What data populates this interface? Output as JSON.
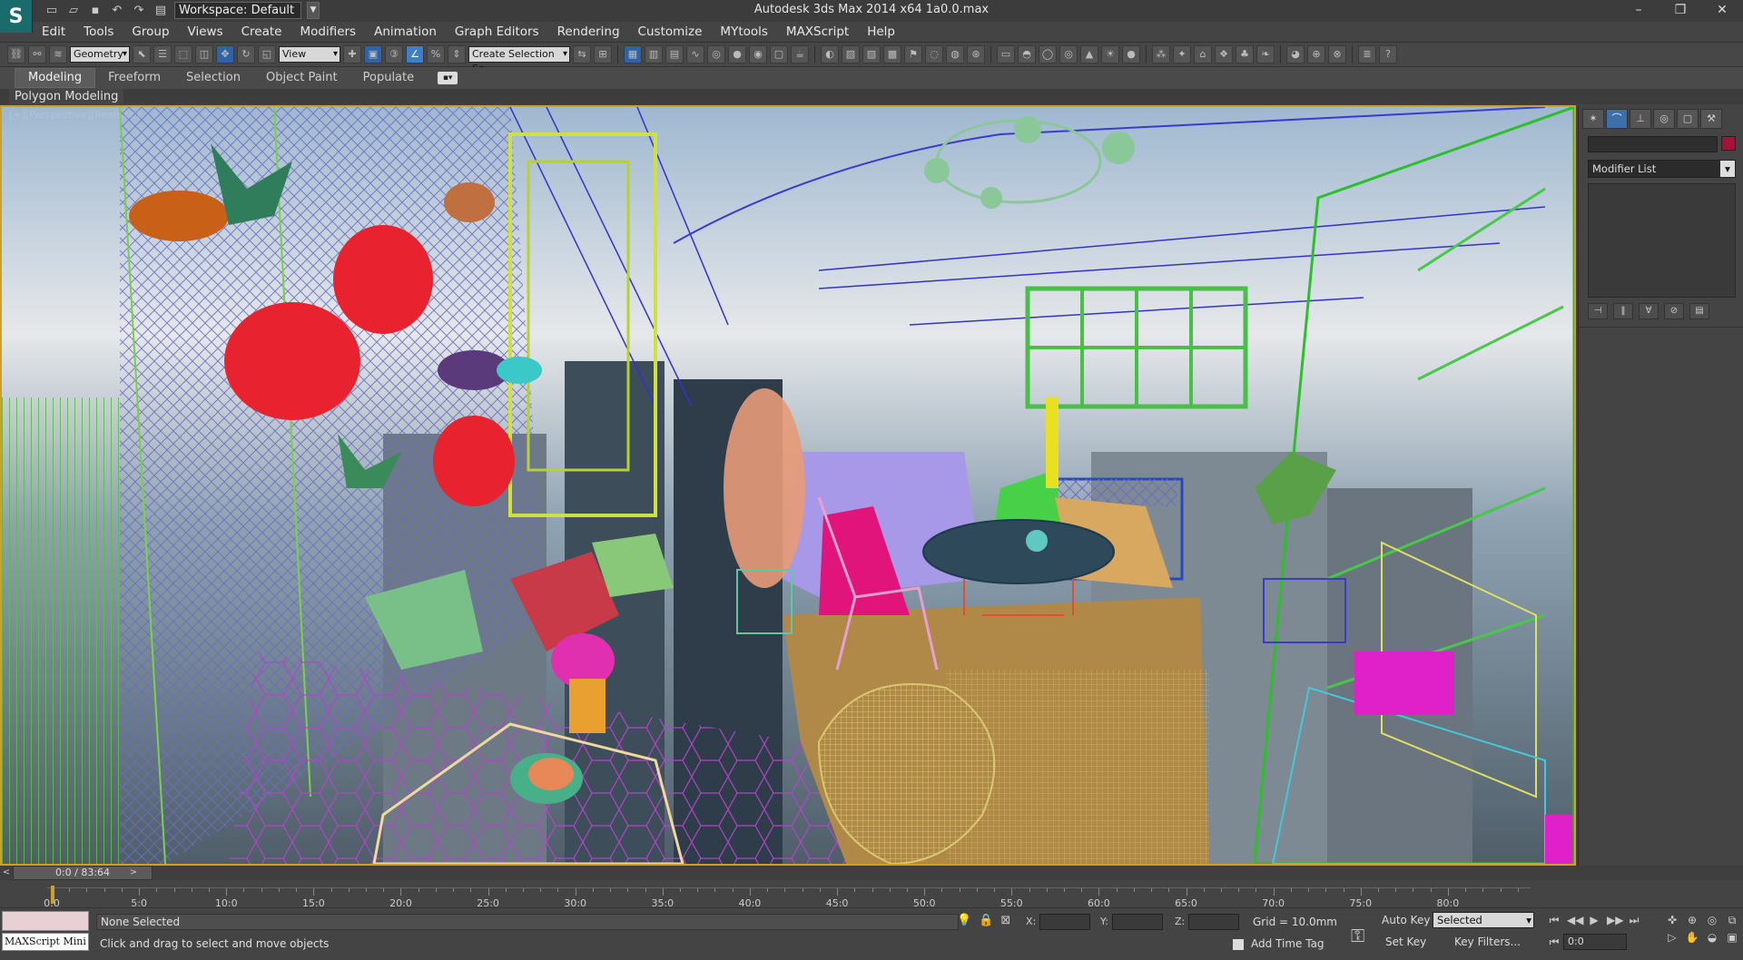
{
  "app": {
    "logo_icon": "3dsmax-logo-icon",
    "workspace": "Workspace: Default",
    "title": "Autodesk 3ds Max  2014 x64      1a0.0.max",
    "window_controls": [
      "minimize-icon",
      "restore-icon",
      "close-icon"
    ]
  },
  "quick_access": [
    "new-file-icon",
    "open-file-icon",
    "save-icon",
    "undo-icon",
    "redo-icon",
    "project-folder-icon"
  ],
  "menu": [
    "Edit",
    "Tools",
    "Group",
    "Views",
    "Create",
    "Modifiers",
    "Animation",
    "Graph Editors",
    "Rendering",
    "Customize",
    "MYtools",
    "MAXScript",
    "Help"
  ],
  "toolbar": {
    "filter_select": "Geometry",
    "ref_coord": "View",
    "named_selection": "Create Selection Se"
  },
  "ribbon": {
    "tabs": [
      "Modeling",
      "Freeform",
      "Selection",
      "Object Paint",
      "Populate"
    ],
    "active_tab": "Modeling",
    "panel_title": "Polygon Modeling"
  },
  "viewport": {
    "label": "[+][Perspective][Realistic]",
    "border_color": "#c9a227"
  },
  "command_panel": {
    "tabs": [
      "create-icon",
      "modify-icon",
      "hierarchy-icon",
      "motion-icon",
      "display-icon",
      "utilities-icon"
    ],
    "active_tab": 1,
    "object_color": "#a0143a",
    "modifier_list": "Modifier List"
  },
  "timeline": {
    "slider_label": "0:0 / 83:64",
    "ticks": [
      "0:0",
      "5:0",
      "10:0",
      "15:0",
      "20:0",
      "25:0",
      "30:0",
      "35:0",
      "40:0",
      "45:0",
      "50:0",
      "55:0",
      "60:0",
      "65:0",
      "70:0",
      "75:0",
      "80:0"
    ]
  },
  "status": {
    "maxscript": "MAXScript Mini",
    "selection": "None Selected",
    "prompt": "Click and drag to select and move objects",
    "x_label": "X:",
    "y_label": "Y:",
    "z_label": "Z:",
    "grid": "Grid = 10.0mm",
    "add_time_tag": "Add Time Tag",
    "auto_key": "Auto Key",
    "set_key": "Set Key",
    "key_mode": "Selected",
    "key_filters": "Key Filters...",
    "frame": "0:0"
  }
}
